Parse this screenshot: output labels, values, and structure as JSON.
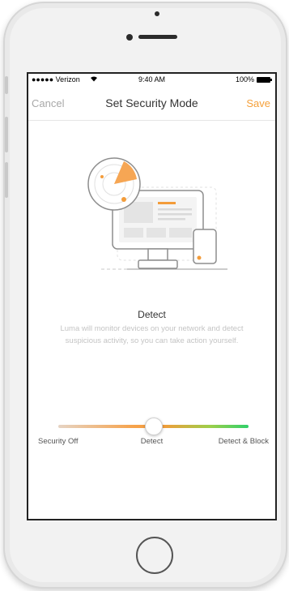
{
  "status_bar": {
    "carrier": "●●●●● Verizon",
    "wifi": "wifi-icon",
    "time": "9:40 AM",
    "battery": "100%"
  },
  "navbar": {
    "cancel_label": "Cancel",
    "title": "Set Security Mode",
    "save_label": "Save"
  },
  "mode": {
    "title": "Detect",
    "description": "Luma will monitor devices on your network and detect suspicious activity, so you can take action yourself."
  },
  "slider": {
    "labels": [
      "Security Off",
      "Detect",
      "Detect & Block"
    ],
    "selected_index": 1,
    "position_fraction": 0.5
  },
  "colors": {
    "accent": "#f5a03a",
    "green": "#2fd06a",
    "muted": "#c4c4c4"
  },
  "icons": {
    "illustration": "radar-monitor-illustration",
    "home": "home-button"
  }
}
